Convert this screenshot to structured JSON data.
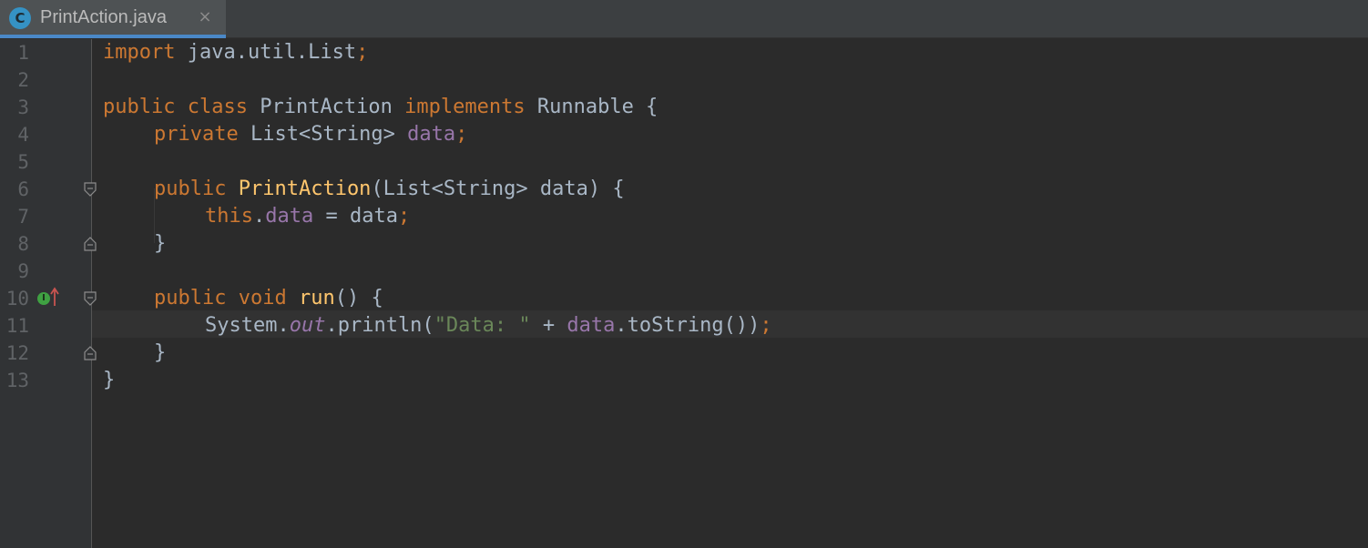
{
  "tab": {
    "icon_letter": "C",
    "title": "PrintAction.java",
    "close": "×"
  },
  "gutter": {
    "line_numbers": [
      "1",
      "2",
      "3",
      "4",
      "5",
      "6",
      "7",
      "8",
      "9",
      "10",
      "11",
      "12",
      "13"
    ],
    "implements_badge": "I"
  },
  "code": {
    "l1": {
      "kw1": "import",
      "rest": " java.util.List",
      "semi": ";"
    },
    "l3": {
      "kw1": "public",
      "kw2": "class",
      "name": " PrintAction ",
      "kw3": "implements",
      "rest": " Runnable {"
    },
    "l4": {
      "kw1": "private",
      "type": " List<String> ",
      "field": "data",
      "semi": ";"
    },
    "l6": {
      "kw1": "public",
      "method": "PrintAction",
      "rest": "(List<String> data) {"
    },
    "l7": {
      "kw1": "this",
      "dot": ".",
      "field": "data",
      "rest": " = data",
      "semi": ";"
    },
    "l8": {
      "text": "}"
    },
    "l10": {
      "kw1": "public",
      "kw2": "void",
      "method": "run",
      "rest": "() {"
    },
    "l11": {
      "cls": "System.",
      "sfield": "out",
      "call": ".println(",
      "str": "\"Data: \"",
      "op": " + ",
      "field": "data",
      "rest": ".toString())",
      "semi": ";"
    },
    "l12": {
      "text": "}"
    },
    "l13": {
      "text": "}"
    }
  },
  "colors": {
    "background": "#2b2b2b",
    "keyword": "#cc7832",
    "method": "#ffc66d",
    "field": "#9876aa",
    "string": "#6a8759",
    "text": "#a9b7c6",
    "line_number": "#606366",
    "tab_underline": "#4a88c7"
  }
}
